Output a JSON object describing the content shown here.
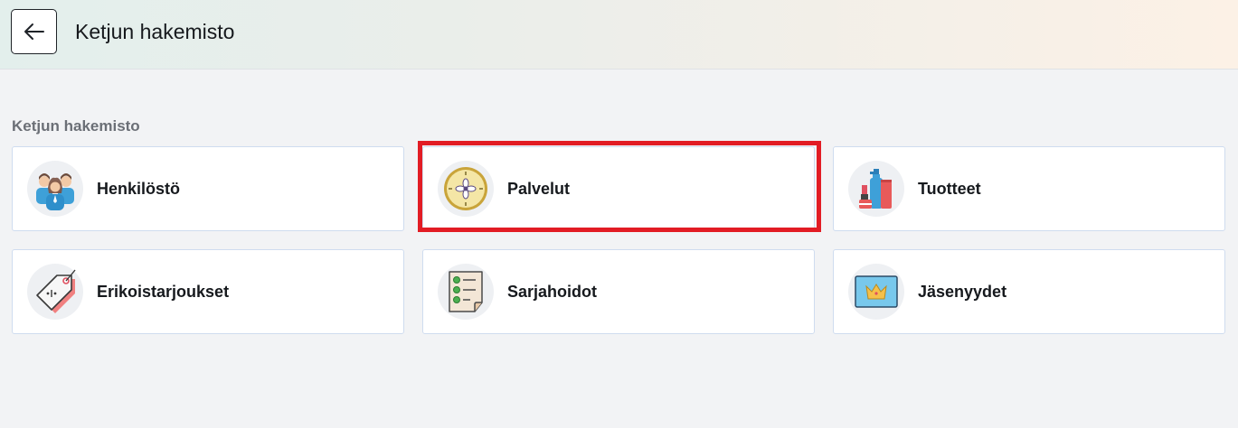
{
  "header": {
    "title": "Ketjun hakemisto",
    "back_icon": "arrow-left-icon"
  },
  "section": {
    "heading": "Ketjun hakemisto"
  },
  "cards": [
    {
      "label": "Henkilöstö",
      "icon": "staff-group-icon"
    },
    {
      "label": "Palvelut",
      "icon": "services-flower-clock-icon",
      "highlighted": true
    },
    {
      "label": "Tuotteet",
      "icon": "beauty-products-icon"
    },
    {
      "label": "Erikoistarjoukset",
      "icon": "price-tag-icon"
    },
    {
      "label": "Sarjahoidot",
      "icon": "checklist-document-icon"
    },
    {
      "label": "Jäsenyydet",
      "icon": "membership-crown-card-icon"
    }
  ],
  "colors": {
    "highlight": "#e21c24",
    "card_border": "#cfdcef",
    "page_background": "#f2f3f5"
  }
}
